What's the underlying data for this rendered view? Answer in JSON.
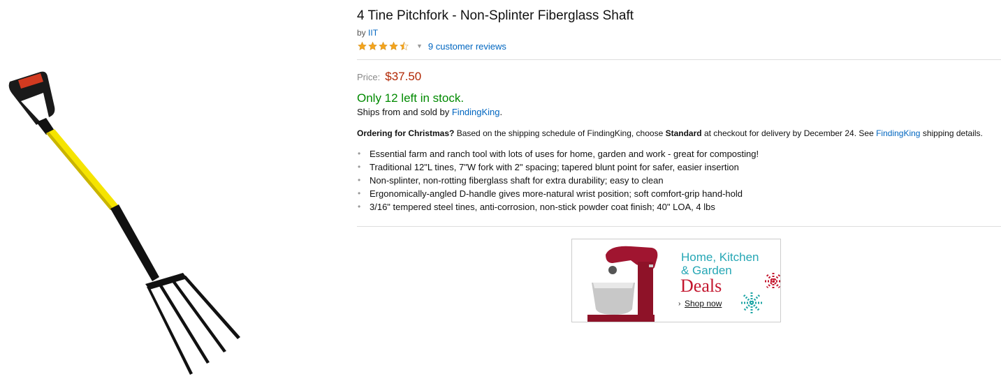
{
  "product": {
    "title": "4 Tine Pitchfork - Non-Splinter Fiberglass Shaft",
    "by_prefix": "by",
    "brand": "IIT",
    "rating_stars": 4.5,
    "reviews_link": "9 customer reviews",
    "price_label": "Price:",
    "price": "$37.50",
    "stock": "Only 12 left in stock.",
    "ships_prefix": "Ships from and sold by",
    "seller": "FindingKing",
    "ships_suffix": "."
  },
  "christmas": {
    "bold_lead": "Ordering for Christmas?",
    "text1": "Based on the shipping schedule of FindingKing, choose",
    "bold_mid": "Standard",
    "text2": "at checkout for delivery by December 24. See",
    "link": "FindingKing",
    "text3": "shipping details."
  },
  "bullets": [
    "Essential farm and ranch tool with lots of uses for home, garden and work - great for composting!",
    "Traditional 12\"L tines, 7\"W fork with 2\" spacing; tapered blunt point for safer, easier insertion",
    "Non-splinter, non-rotting fiberglass shaft for extra durability; easy to clean",
    "Ergonomically-angled D-handle gives more-natural wrist position; soft comfort-grip hand-hold",
    "3/16\" tempered steel tines, anti-corrosion, non-stick powder coat finish; 40\" LOA, 4 lbs"
  ],
  "ad": {
    "line1": "Home, Kitchen",
    "line2": "& Garden",
    "deals": "Deals",
    "shop": "Shop now"
  },
  "colors": {
    "link": "#0066c0",
    "price": "#b12704",
    "stock": "#008a00",
    "star": "#f4a41c"
  }
}
